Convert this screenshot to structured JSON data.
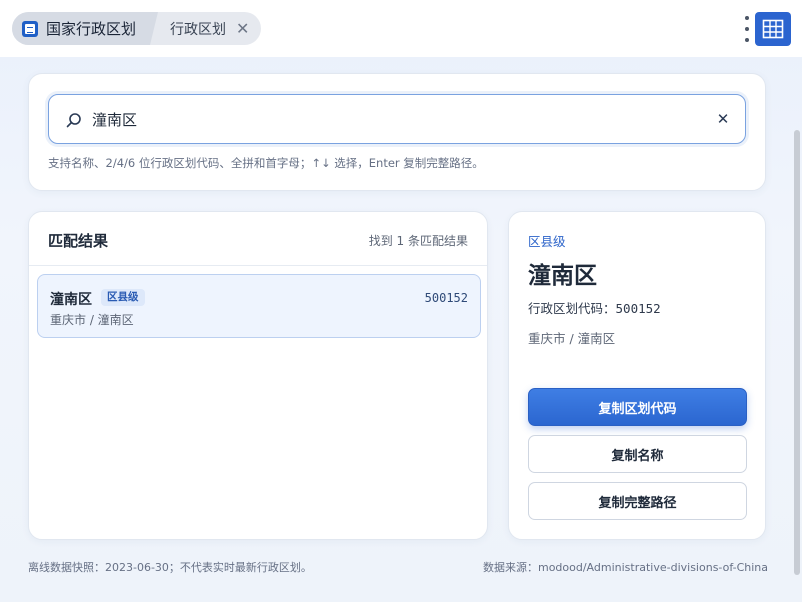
{
  "titlebar": {
    "app_tab_label": "国家行政区划",
    "page_tab_label": "行政区划",
    "close_glyph": "✕"
  },
  "search": {
    "value": "潼南区",
    "placeholder": "",
    "clear_glyph": "✕",
    "hint": "支持名称、2/4/6 位行政区划代码、全拼和首字母；↑↓ 选择，Enter 复制完整路径。"
  },
  "results": {
    "title": "匹配结果",
    "count_text": "找到 1 条匹配结果",
    "items": [
      {
        "name": "潼南区",
        "level": "区县级",
        "code": "500152",
        "path": "重庆市 / 潼南区"
      }
    ]
  },
  "detail": {
    "level": "区县级",
    "name": "潼南区",
    "code_label": "行政区划代码：",
    "code": "500152",
    "path": "重庆市 / 潼南区",
    "btn_copy_code": "复制区划代码",
    "btn_copy_name": "复制名称",
    "btn_copy_path": "复制完整路径"
  },
  "footer": {
    "snapshot": "离线数据快照：2023-06-30；不代表实时最新行政区划。",
    "source": "数据来源：modood/Administrative-divisions-of-China"
  },
  "colors": {
    "accent": "#2b64cf",
    "selected_bg": "#eef4fe",
    "page_bg": "#eef3fb"
  },
  "icons": {
    "app": "app-document-icon",
    "search": "search-icon",
    "clear": "close-icon",
    "menu": "kebab-menu-icon",
    "grid": "grid-icon"
  }
}
